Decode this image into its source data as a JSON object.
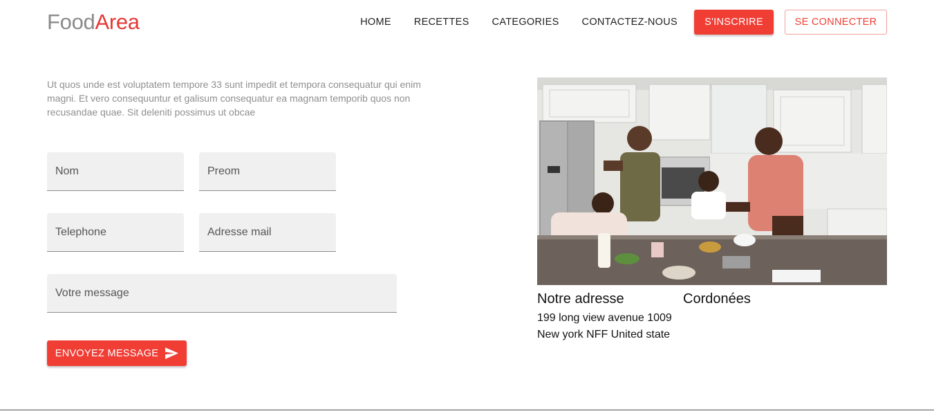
{
  "header": {
    "logo_part1": "Food",
    "logo_part2": "Area",
    "nav": [
      "HOME",
      "RECETTES",
      "CATEGORIES",
      "CONTACTEZ-NOUS"
    ],
    "signup_label": "S'INSCRIRE",
    "login_label": "SE CONNECTER"
  },
  "intro": {
    "text": "Ut quos unde est voluptatem tempore 33 sunt impedit et tempora consequatur qui enim magni. Et vero consequuntur et galisum consequatur ea magnam temporib quos non recusandae quae. Sit deleniti possimus ut obcae"
  },
  "form": {
    "nom_placeholder": "Nom",
    "preom_placeholder": "Preom",
    "telephone_placeholder": "Telephone",
    "email_placeholder": "Adresse mail",
    "message_placeholder": "Votre message",
    "send_label": "ENVOYEZ MESSAGE",
    "send_icon": "send-icon"
  },
  "contact": {
    "address_title": "Notre adresse",
    "address_line1": "199 long view avenue 1009",
    "address_line2": "New york NFF United state",
    "coordinates_title": "Cordonées"
  },
  "colors": {
    "accent": "#f03e35",
    "logo_gray": "#8a8a8a",
    "field_bg": "#f0f0f0"
  }
}
